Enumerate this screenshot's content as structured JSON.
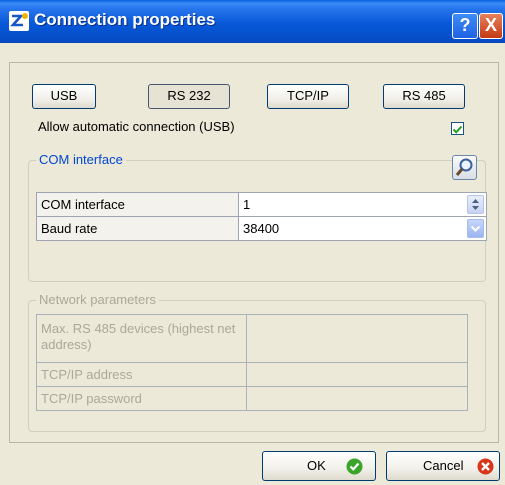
{
  "window": {
    "title": "Connection properties",
    "help_label": "?",
    "close_label": "X"
  },
  "interface_buttons": [
    {
      "label": "USB",
      "pressed": false
    },
    {
      "label": "RS 232",
      "pressed": true
    },
    {
      "label": "TCP/IP",
      "pressed": false
    },
    {
      "label": "RS 485",
      "pressed": false
    }
  ],
  "auto_connect": {
    "label": "Allow automatic connection (USB)",
    "checked": true
  },
  "com_group": {
    "legend": "COM interface",
    "search_icon": "magnifier-icon",
    "rows": [
      {
        "label": "COM interface",
        "value": "1",
        "control": "spin"
      },
      {
        "label": "Baud rate",
        "value": "38400",
        "control": "dropdown"
      }
    ]
  },
  "network_group": {
    "legend": "Network parameters",
    "enabled": false,
    "rows": [
      {
        "label": "Max. RS 485 devices (highest net address)",
        "value": ""
      },
      {
        "label": "TCP/IP address",
        "value": ""
      },
      {
        "label": "TCP/IP password",
        "value": ""
      }
    ]
  },
  "footer": {
    "ok_label": "OK",
    "cancel_label": "Cancel"
  },
  "colors": {
    "titlebar": "#0758d8",
    "legend_active": "#0046d5",
    "legend_disabled": "#aca899",
    "ok_icon": "#3aa52a",
    "cancel_icon": "#d8361a"
  }
}
